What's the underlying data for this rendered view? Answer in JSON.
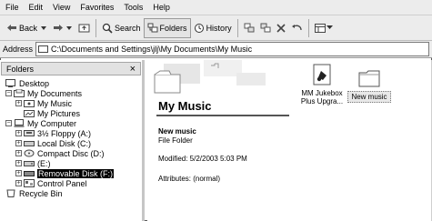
{
  "menu": [
    "File",
    "Edit",
    "View",
    "Favorites",
    "Tools",
    "Help"
  ],
  "toolbar": {
    "back": "Back",
    "search": "Search",
    "folders": "Folders",
    "history": "History"
  },
  "address": {
    "label": "Address",
    "value": "C:\\Documents and Settings\\jlj\\My Documents\\My Music"
  },
  "sidebar": {
    "title": "Folders",
    "close": "×",
    "items": [
      {
        "label": "Desktop"
      },
      {
        "label": "My Documents"
      },
      {
        "label": "My Music"
      },
      {
        "label": "My Pictures"
      },
      {
        "label": "My Computer"
      },
      {
        "label": "3½ Floppy (A:)"
      },
      {
        "label": "Local Disk (C:)"
      },
      {
        "label": "Compact Disc (D:)"
      },
      {
        "label": "(E:)"
      },
      {
        "label": "Removable Disk (F:)"
      },
      {
        "label": "Control Panel"
      },
      {
        "label": "Recycle Bin"
      }
    ]
  },
  "main": {
    "title": "My Music",
    "selected_name": "New music",
    "selected_type": "File Folder",
    "modified": "Modified: 5/2/2003 5:03 PM",
    "attributes": "Attributes: (normal)",
    "icons": [
      {
        "label_line1": "MM Jukebox",
        "label_line2": "Plus Upgra...",
        "icon": "jukebox-icon"
      },
      {
        "label_line1": "New music",
        "icon": "folder-icon"
      }
    ]
  }
}
